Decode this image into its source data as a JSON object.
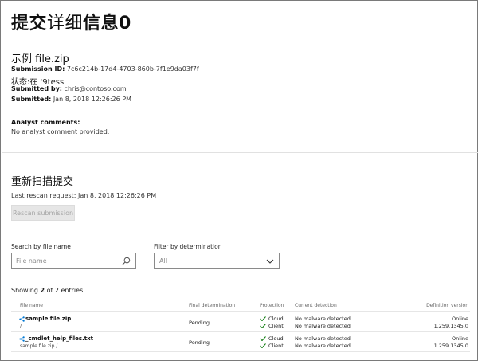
{
  "header": {
    "title_bold_1": "提交",
    "title_light": "详细",
    "title_bold_2": "信息0"
  },
  "submission": {
    "section_title": "示例 file.zip",
    "id_label": "Submission ID:",
    "id_value": "7c6c214b-17d4-4703-860b-7f1e9da03f7f",
    "status_text": "状态:在 '9tess",
    "submitted_by_label": "Submitted by:",
    "submitted_by_value": "chris@contoso.com",
    "submitted_label": "Submitted:",
    "submitted_value": "Jan 8, 2018 12:26:26 PM"
  },
  "analyst": {
    "label": "Analyst comments:",
    "text": "No analyst comment provided."
  },
  "rescan": {
    "section_title": "重新扫描提交",
    "last_request": "Last rescan request: Jan 8, 2018 12:26:26 PM",
    "button_label": "Rescan submission"
  },
  "filters": {
    "search_label": "Search by file name",
    "search_placeholder": "File name",
    "filter_label": "Filter by determination",
    "filter_value": "All"
  },
  "entries": {
    "prefix": "Showing ",
    "count": "2",
    "suffix": " of 2 entries"
  },
  "table": {
    "headers": {
      "file_name": "File name",
      "final_determination": "Final determination",
      "protection": "Protection",
      "current_detection": "Current detection",
      "definition_version": "Definition version"
    },
    "rows": [
      {
        "name": "sample file.zip",
        "path": "/",
        "determination": "Pending",
        "protection": [
          "Cloud",
          "Client"
        ],
        "detection": [
          "No malware detected",
          "No malware detected"
        ],
        "definition": [
          "Online",
          "1.259.1345.0"
        ]
      },
      {
        "name": "_cmdlet_help_files.txt",
        "path": "sample file.zip /",
        "determination": "Pending",
        "protection": [
          "Cloud",
          "Client"
        ],
        "detection": [
          "No malware detected",
          "No malware detected"
        ],
        "definition": [
          "Online",
          "1.259.1345.0"
        ]
      }
    ]
  },
  "colors": {
    "check_green": "#107c10",
    "link_blue": "#0078d4",
    "disabled_button": "#e6e6e6"
  },
  "icons": {
    "search": "search-icon",
    "dropdown": "chevron-down-icon",
    "share": "share-icon",
    "check": "checkmark-icon"
  }
}
